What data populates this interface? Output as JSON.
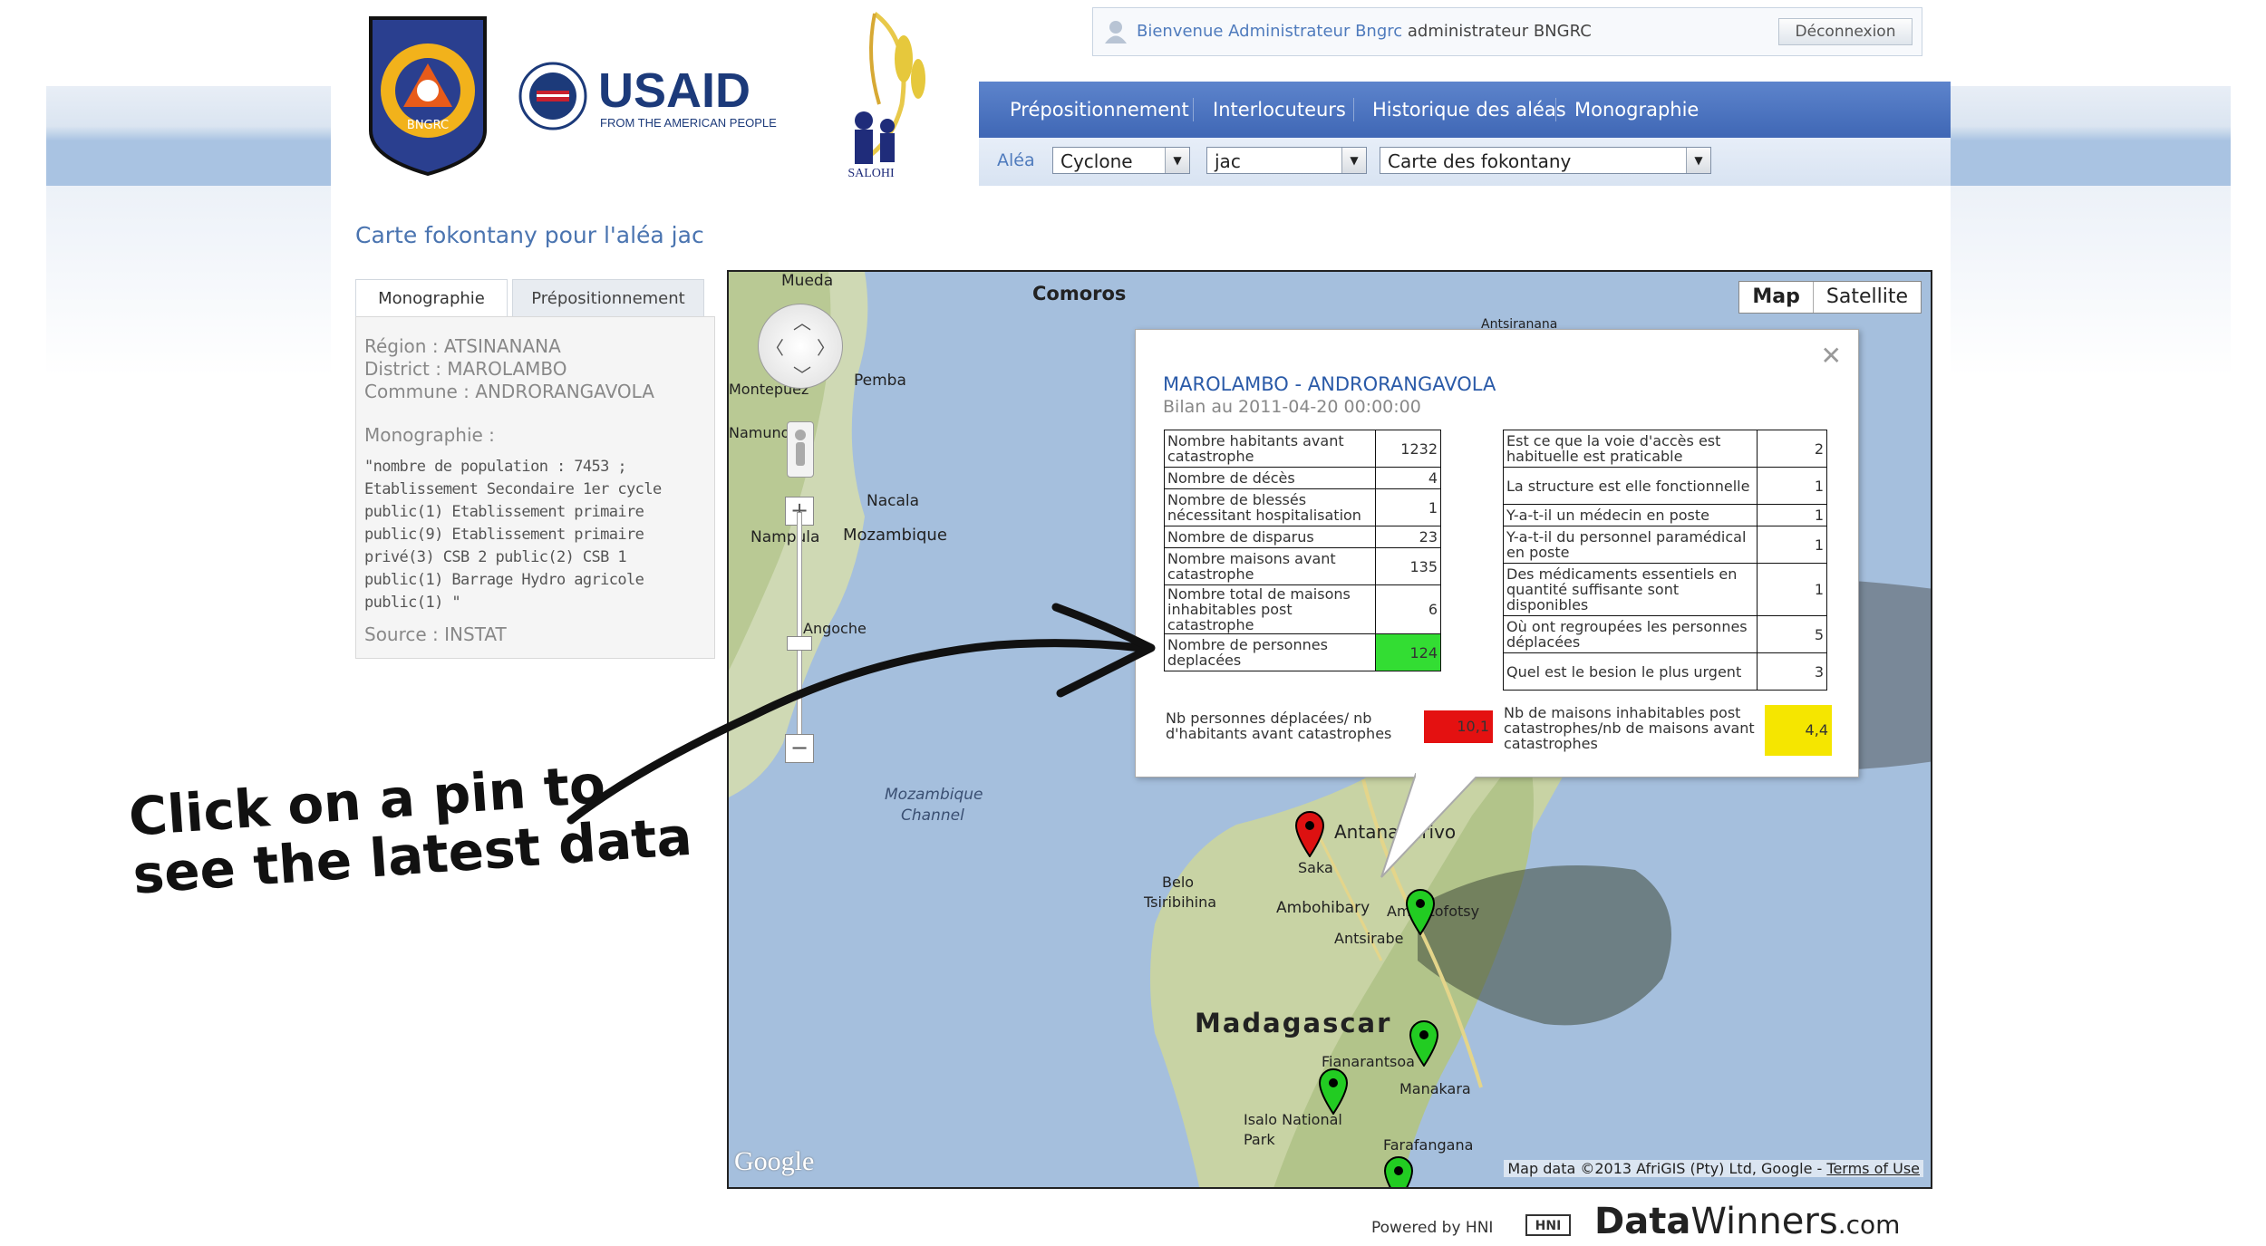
{
  "header": {
    "welcome_text": "Bienvenue Administrateur Bngrc",
    "welcome_user": "administrateur BNGRC",
    "logout_label": "Déconnexion",
    "logos": {
      "bngrc_text": "BNGRC",
      "usaid_text": "USAID",
      "usaid_sub": "FROM THE AMERICAN PEOPLE",
      "salohi_text": "SALOHI"
    }
  },
  "nav": {
    "items": [
      {
        "label": "Prépositionnement"
      },
      {
        "label": "Interlocuteurs"
      },
      {
        "label": "Historique des aléas"
      },
      {
        "label": "Monographie"
      }
    ]
  },
  "filters": {
    "label": "Aléa",
    "alea_type": "Cyclone",
    "alea_name": "jac",
    "map_type": "Carte des fokontany"
  },
  "page_title": "Carte fokontany pour l'aléa jac",
  "left_panel": {
    "tabs": [
      "Monographie",
      "Prépositionnement"
    ],
    "region": "Région : ATSINANANA",
    "district": "District : MAROLAMBO",
    "commune": "Commune : ANDRORANGAVOLA",
    "monographie_label": "Monographie :",
    "monographie_text": "\"nombre de population : 7453 ; Etablissement Secondaire 1er cycle public(1) Etablissement primaire public(9) Etablissement primaire privé(3) CSB 2 public(2) CSB 1 public(1) Barrage Hydro agricole public(1) \"",
    "source": "Source : INSTAT"
  },
  "map": {
    "buttons": {
      "map": "Map",
      "satellite": "Satellite"
    },
    "labels": {
      "mueda": "Mueda",
      "comoros": "Comoros",
      "antsiranana": "Antsiranana",
      "montepuez": "Montepuez",
      "pemba": "Pemba",
      "namuno": "Namuno",
      "nacala": "Nacala",
      "nampula": "Nampula",
      "mozambique": "Mozambique",
      "angoche": "Angoche",
      "mozambique_channel_1": "Mozambique",
      "mozambique_channel_2": "Channel",
      "antananarivo": "Antananarivo",
      "saka": "Saka",
      "belo": "Belo",
      "tsiribihina": "Tsiribihina",
      "ambohibary": "Ambohibary",
      "ambatofotsy": "Ambatofotsy",
      "antsirabe": "Antsirabe",
      "madagascar": "Madagascar",
      "fianarantsoa": "Fianarantsoa",
      "manakara": "Manakara",
      "isalo_1": "Isalo National",
      "isalo_2": "Park",
      "farafangana": "Farafangana"
    },
    "google": "Google",
    "attribution": "Map data ©2013 AfriGIS (Pty) Ltd, Google - ",
    "terms": "Terms of Use",
    "pin_colors": {
      "selected": "#dd1111",
      "normal": "#22cc22"
    }
  },
  "infowindow": {
    "title": "MAROLAMBO - ANDRORANGAVOLA",
    "date": "Bilan au 2011-04-20 00:00:00",
    "left_rows": [
      {
        "label": "Nombre habitants avant catastrophe",
        "value": "1232"
      },
      {
        "label": "Nombre de décès",
        "value": "4"
      },
      {
        "label": "Nombre de blessés nécessitant hospitalisation",
        "value": "1"
      },
      {
        "label": "Nombre de disparus",
        "value": "23"
      },
      {
        "label": "Nombre maisons avant catastrophe",
        "value": "135"
      },
      {
        "label": "Nombre total de maisons inhabitables post catastrophe",
        "value": "6"
      },
      {
        "label": "Nombre de personnes deplacées",
        "value": "124",
        "highlight": "#33dd33"
      }
    ],
    "right_rows": [
      {
        "label": "Est ce que la voie d'accès est habituelle est praticable",
        "value": "2"
      },
      {
        "label": "La structure est elle fonctionnelle",
        "value": "1"
      },
      {
        "label": "Y-a-t-il un médecin en poste",
        "value": "1"
      },
      {
        "label": "Y-a-t-il du personnel paramédical en poste",
        "value": "1"
      },
      {
        "label": "Des médicaments essentiels en quantité suffisante sont disponibles",
        "value": "1"
      },
      {
        "label": "Où ont regroupées les personnes déplacées",
        "value": "5"
      },
      {
        "label": "Quel est le besion le plus urgent",
        "value": "3"
      }
    ],
    "ratio_left_label": "Nb personnes déplacées/ nb d'habitants avant catastrophes",
    "ratio_left_value": "10,1",
    "ratio_left_color": "#e41111",
    "ratio_right_label": "Nb de maisons inhabitables post catastrophes/nb de maisons avant catastrophes",
    "ratio_right_value": "4,4",
    "ratio_right_color": "#f5e600"
  },
  "annotation": {
    "line1": "Click on a pin to",
    "line2": "see the latest data"
  },
  "footer": {
    "powered": "Powered by HNI",
    "hni": "HNI",
    "dw_bold": "Data",
    "dw_rest": "Winners",
    "dw_suffix": ".com"
  }
}
